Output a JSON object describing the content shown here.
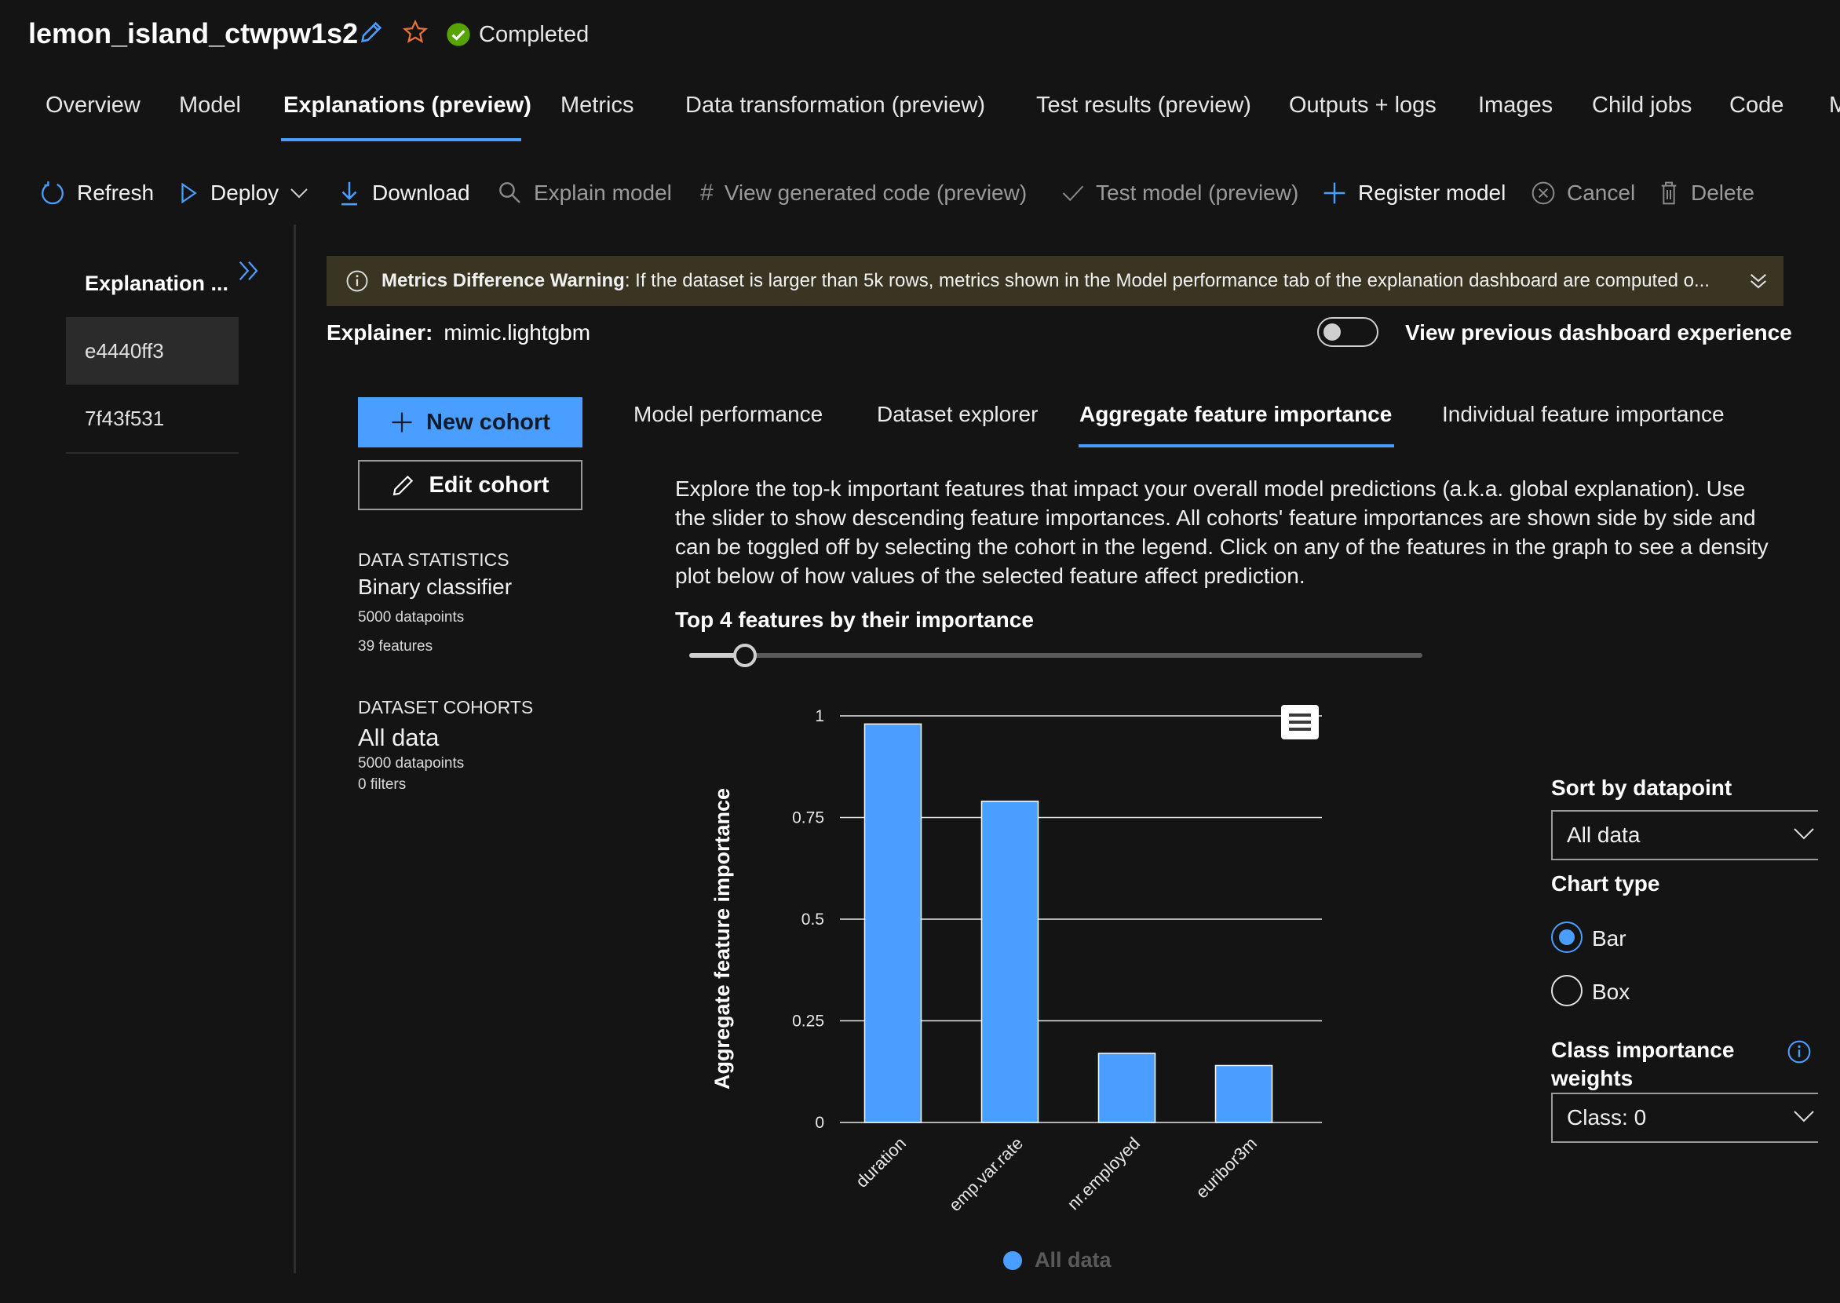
{
  "header": {
    "job_title": "lemon_island_ctwpw1s2",
    "status": "Completed"
  },
  "main_tabs": [
    {
      "label": "Overview"
    },
    {
      "label": "Model"
    },
    {
      "label": "Explanations (preview)",
      "active": true
    },
    {
      "label": "Metrics"
    },
    {
      "label": "Data transformation (preview)"
    },
    {
      "label": "Test results (preview)"
    },
    {
      "label": "Outputs + logs"
    },
    {
      "label": "Images"
    },
    {
      "label": "Child jobs"
    },
    {
      "label": "Code"
    },
    {
      "label": "M"
    }
  ],
  "toolbar": {
    "refresh": "Refresh",
    "deploy": "Deploy",
    "download": "Download",
    "explain_model": "Explain model",
    "view_code": "View generated code (preview)",
    "test_model": "Test model (preview)",
    "register_model": "Register model",
    "cancel": "Cancel",
    "delete": "Delete"
  },
  "sidebar": {
    "header": "Explanation ...",
    "items": [
      {
        "label": "e4440ff3",
        "selected": true
      },
      {
        "label": "7f43f531"
      }
    ]
  },
  "warning": {
    "title": "Metrics Difference Warning",
    "text": ": If the dataset is larger than 5k rows, metrics shown in the Model performance tab of the explanation dashboard are computed o..."
  },
  "explainer": {
    "label": "Explainer:",
    "value": "mimic.lightgbm"
  },
  "toggle": {
    "label": "View previous dashboard experience",
    "on": false
  },
  "cohort_panel": {
    "new_cohort": "New cohort",
    "edit_cohort": "Edit cohort",
    "data_statistics_label": "DATA STATISTICS",
    "classifier": "Binary classifier",
    "datapoints": "5000 datapoints",
    "features": "39 features",
    "dataset_cohorts_label": "DATASET COHORTS",
    "cohort_name": "All data",
    "cohort_datapoints": "5000 datapoints",
    "cohort_filters": "0 filters"
  },
  "inner_tabs": [
    {
      "label": "Model performance"
    },
    {
      "label": "Dataset explorer"
    },
    {
      "label": "Aggregate feature importance",
      "active": true
    },
    {
      "label": "Individual feature importance"
    }
  ],
  "description": "Explore the top-k important features that impact your overall model predictions (a.k.a. global explanation). Use the slider to show descending feature importances. All cohorts' feature importances are shown side by side and can be toggled off by selecting the cohort in the legend. Click on any of the features in the graph to see a density plot below of how values of the selected feature affect prediction.",
  "top_k_label": "Top 4 features by their importance",
  "slider": {
    "value": 4
  },
  "right_panel": {
    "sort_label": "Sort by datapoint",
    "sort_value": "All data",
    "chart_type_label": "Chart type",
    "chart_types": [
      {
        "label": "Bar",
        "selected": true
      },
      {
        "label": "Box",
        "selected": false
      }
    ],
    "class_weights_label_1": "Class importance",
    "class_weights_label_2": "weights",
    "class_value": "Class: 0"
  },
  "chart_data": {
    "type": "bar",
    "ylabel": "Aggregate feature importance",
    "categories": [
      "duration",
      "emp.var.rate",
      "nr.employed",
      "euribor3m"
    ],
    "series": [
      {
        "name": "All data",
        "values": [
          0.98,
          0.79,
          0.17,
          0.14
        ]
      }
    ],
    "ylim": [
      0,
      1
    ],
    "yticks": [
      "0",
      "0.25",
      "0.5",
      "0.75",
      "1"
    ],
    "ytick_values": [
      0,
      0.25,
      0.5,
      0.75,
      1
    ],
    "grid": true,
    "bar_color": "#4a9eff",
    "legend_position": "bottom"
  },
  "colors": {
    "accent": "#4a9eff",
    "background": "#141414",
    "warning_bg": "#3a3422",
    "success": "#57a300",
    "star": "#e8733a"
  }
}
